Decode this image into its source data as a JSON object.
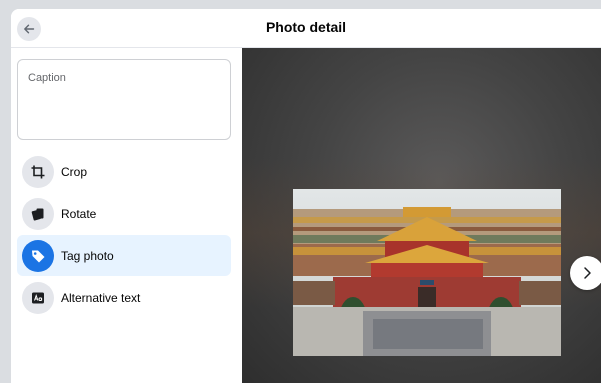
{
  "header": {
    "title": "Photo detail",
    "back_icon": "arrow-left-icon"
  },
  "caption": {
    "placeholder": "Caption",
    "value": ""
  },
  "actions": [
    {
      "label": "Crop",
      "icon": "crop-icon",
      "active": false
    },
    {
      "label": "Rotate",
      "icon": "rotate-icon",
      "active": false
    },
    {
      "label": "Tag photo",
      "icon": "tag-icon",
      "active": true
    },
    {
      "label": "Alternative text",
      "icon": "alt-text-icon",
      "active": false
    }
  ],
  "viewer": {
    "next_icon": "chevron-right-icon"
  },
  "colors": {
    "accent": "#1b74e4",
    "active_bg": "#e7f3ff",
    "icon_bg": "#e4e6eb"
  }
}
